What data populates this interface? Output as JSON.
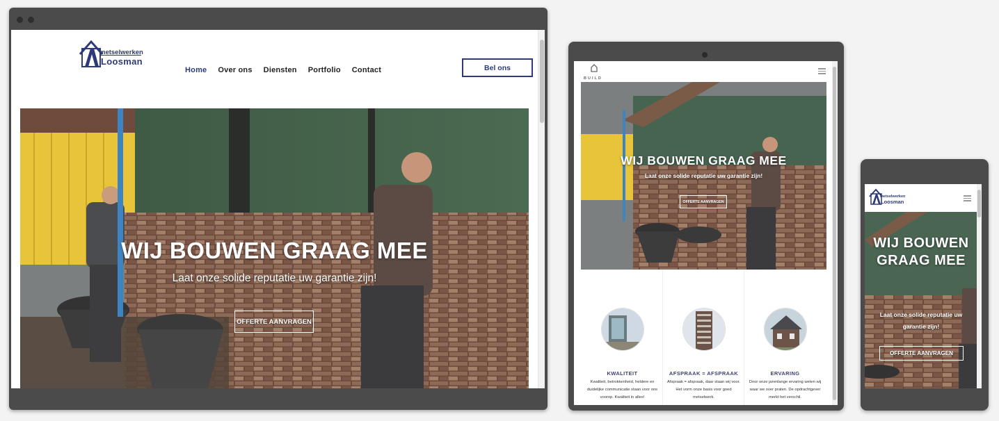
{
  "desktop": {
    "logo": {
      "line1": "metselwerken",
      "line2": "Loosman"
    },
    "nav": [
      "Home",
      "Over ons",
      "Diensten",
      "Portfolio",
      "Contact"
    ],
    "cta": "Bel ons",
    "hero": {
      "title": "WIJ BOUWEN GRAAG MEE",
      "subtitle": "Laat onze solide reputatie uw garantie zijn!",
      "button": "OFFERTE AANVRAGEN"
    }
  },
  "tablet": {
    "logo_text": "BUILD",
    "hero": {
      "title": "WIJ BOUWEN GRAAG MEE",
      "subtitle": "Laat onze solide reputatie uw garantie zijn!",
      "button": "OFFERTE AANVRAGEN"
    },
    "features": [
      {
        "title": "KWALITEIT",
        "body": "Kwaliteit, betrokkenheid, heldere en duidelijke communicatie staan voor ons voorop. Kwaliteit in alles!"
      },
      {
        "title": "AFSPRAAK = AFSPRAAK",
        "body": "Afspraak = afspraak, daar staan wij voor. Het vorm onze basis voor goed metselwerk."
      },
      {
        "title": "ERVARING",
        "body": "Door onze jarenlange ervaring weten wij waar we over praten. De opdrachtgever merkt het verschil."
      }
    ]
  },
  "phone": {
    "logo": {
      "line1": "metselwerken",
      "line2": "Loosman"
    },
    "hero": {
      "title": "WIJ BOUWEN GRAAG MEE",
      "subtitle": "Laat onze solide reputatie uw garantie zijn!",
      "button": "OFFERTE AANVRAGEN"
    }
  },
  "colors": {
    "brand": "#2e3a78",
    "device_frame": "#4b4b4b",
    "feature_title": "#3d3f7a"
  },
  "icons": [
    "menu-icon",
    "scrollbar"
  ]
}
